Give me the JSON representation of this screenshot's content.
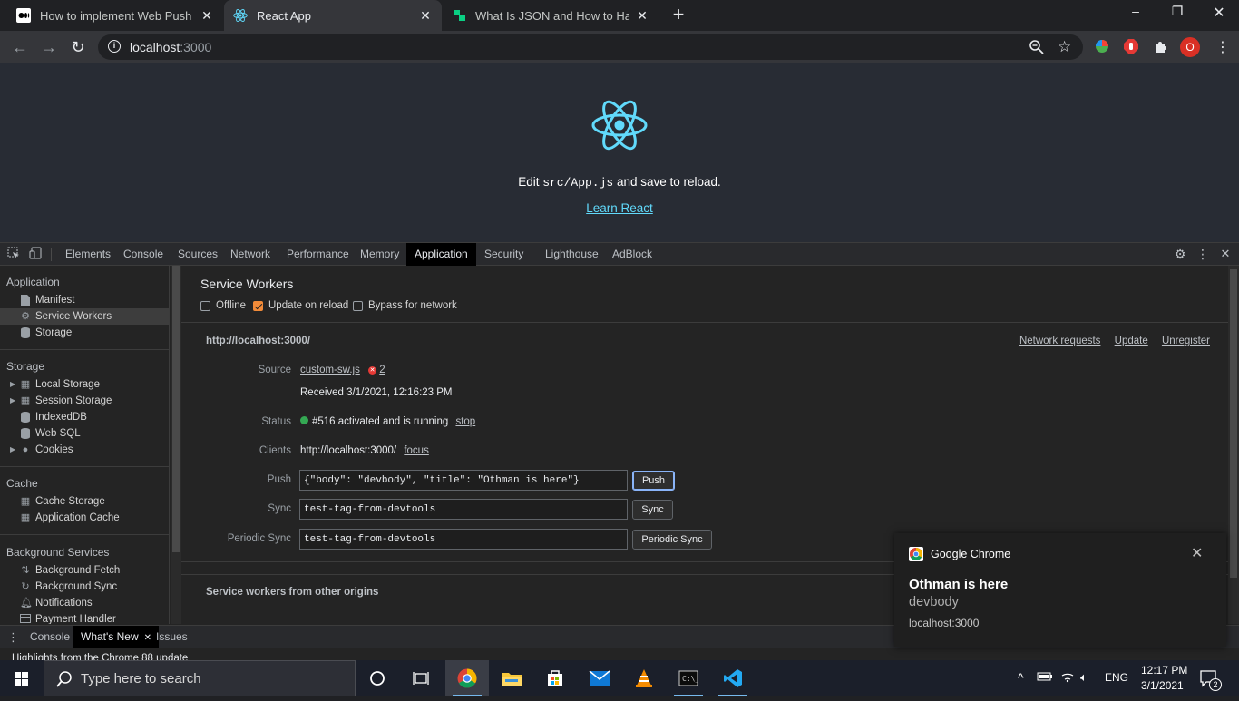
{
  "browser": {
    "tabs": [
      {
        "title": "How to implement Web Push No",
        "icon": "medium-icon"
      },
      {
        "title": "React App",
        "icon": "react-icon",
        "active": true
      },
      {
        "title": "What Is JSON and How to Handle",
        "icon": "site-icon"
      }
    ],
    "new_tab": "+",
    "window_controls": {
      "minimize": "–",
      "maximize": "❐",
      "close": "✕"
    },
    "url_host": "localhost",
    "url_port": ":3000",
    "profile_initial": "O"
  },
  "page": {
    "edit_prefix": "Edit ",
    "edit_code": "src/App.js",
    "edit_suffix": " and save to reload.",
    "learn_link": "Learn React",
    "react_color": "#61dafb"
  },
  "devtools": {
    "tabs": [
      "Elements",
      "Console",
      "Sources",
      "Network",
      "Performance",
      "Memory",
      "Application",
      "Security",
      "Lighthouse",
      "AdBlock"
    ],
    "active_tab": "Application",
    "sidebar": {
      "sections": [
        {
          "heading": "Application",
          "items": [
            "Manifest",
            "Service Workers",
            "Storage"
          ]
        },
        {
          "heading": "Storage",
          "items": [
            "Local Storage",
            "Session Storage",
            "IndexedDB",
            "Web SQL",
            "Cookies"
          ]
        },
        {
          "heading": "Cache",
          "items": [
            "Cache Storage",
            "Application Cache"
          ]
        },
        {
          "heading": "Background Services",
          "items": [
            "Background Fetch",
            "Background Sync",
            "Notifications",
            "Payment Handler"
          ]
        }
      ]
    },
    "service_workers": {
      "title": "Service Workers",
      "options": {
        "offline": "Offline",
        "update_on_reload": "Update on reload",
        "bypass": "Bypass for network"
      },
      "origin": "http://localhost:3000/",
      "links": {
        "network_requests": "Network requests",
        "update": "Update",
        "unregister": "Unregister"
      },
      "labels": {
        "source": "Source",
        "status": "Status",
        "clients": "Clients",
        "push": "Push",
        "sync": "Sync",
        "periodic_sync": "Periodic Sync"
      },
      "source_file": "custom-sw.js",
      "error_count": "2",
      "received": "Received 3/1/2021, 12:16:23 PM",
      "status_text": "#516 activated and is running",
      "stop": "stop",
      "clients_url": "http://localhost:3000/",
      "focus": "focus",
      "push_value": "{\"body\": \"devbody\", \"title\": \"Othman is here\"}",
      "push_button": "Push",
      "sync_value": "test-tag-from-devtools",
      "sync_button": "Sync",
      "periodic_value": "test-tag-from-devtools",
      "periodic_button": "Periodic Sync",
      "other_origins": "Service workers from other origins"
    },
    "drawer": {
      "tabs": [
        "Console",
        "What's New",
        "Issues"
      ],
      "active_tab": "What's New",
      "highlight": "Highlights from the Chrome 88 update"
    }
  },
  "notification": {
    "app": "Google Chrome",
    "title": "Othman is here",
    "body": "devbody",
    "source": "localhost:3000"
  },
  "taskbar": {
    "search_placeholder": "Type here to search",
    "language": "ENG",
    "time": "12:17 PM",
    "date": "3/1/2021",
    "notifications_count": "2"
  }
}
